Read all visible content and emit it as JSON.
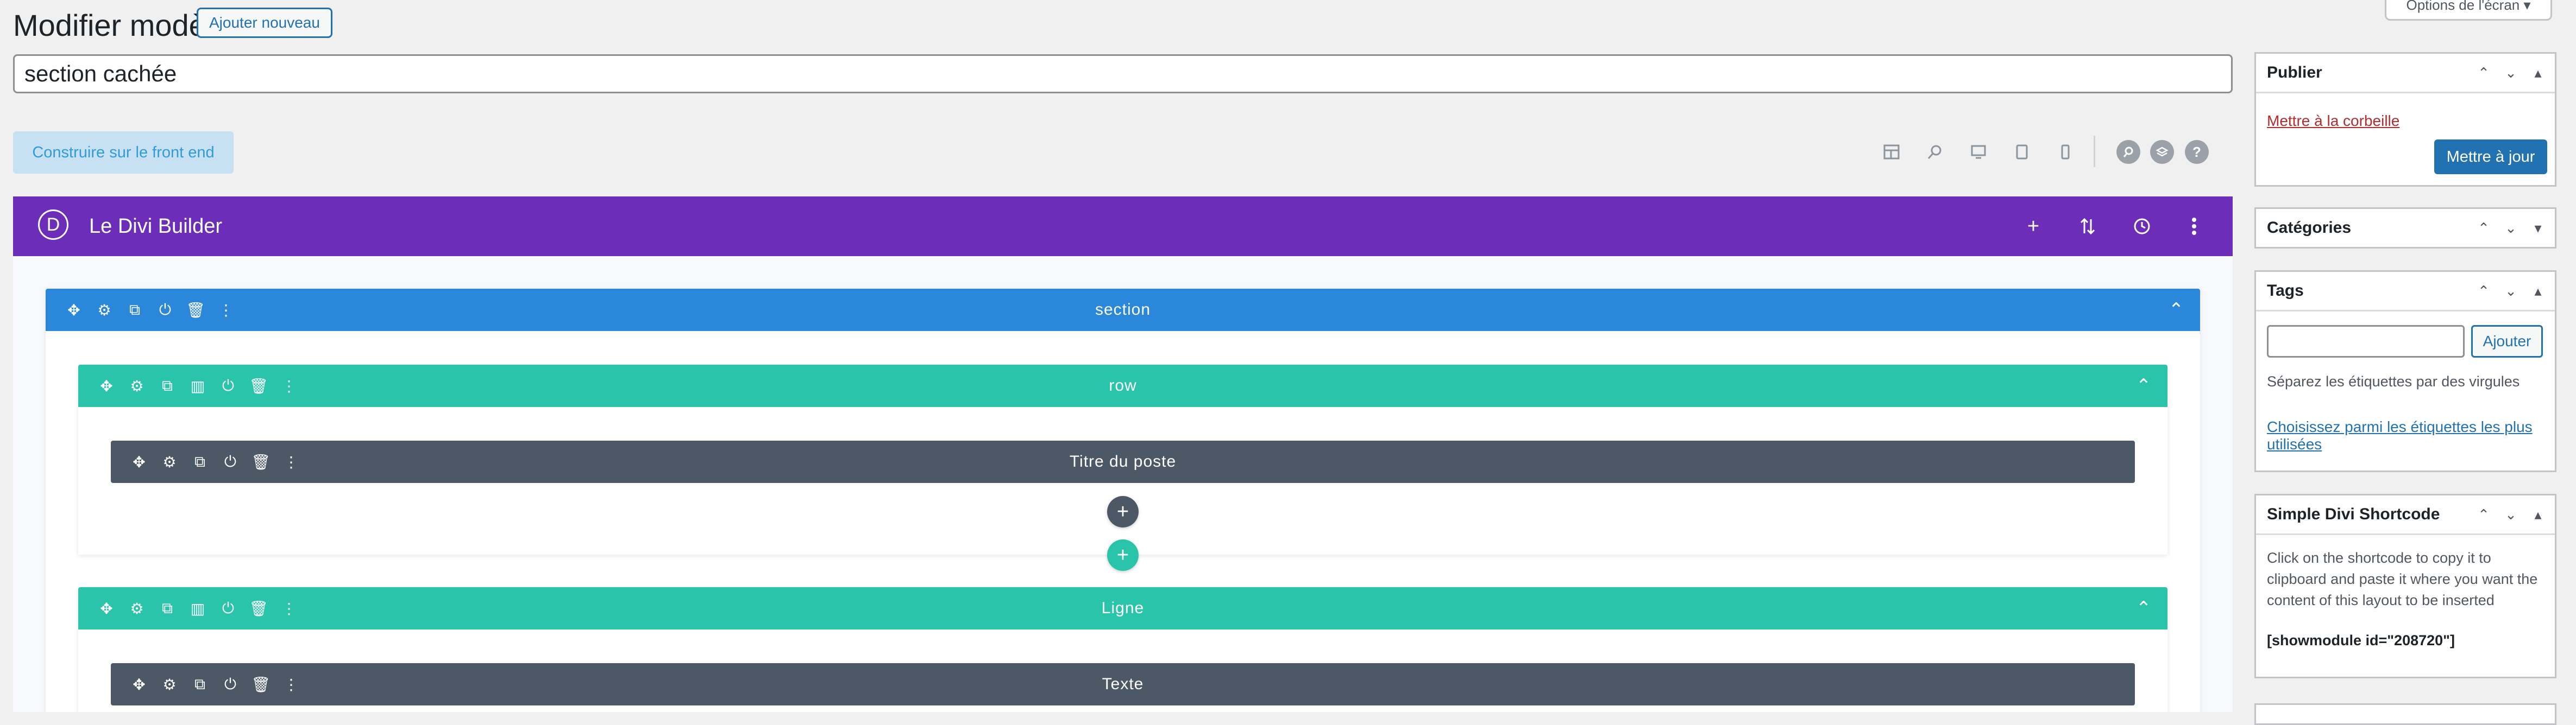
{
  "header": {
    "title": "Modifier modèle",
    "add_new": "Ajouter nouveau",
    "screen_options": "Options de l'écran ▾"
  },
  "post": {
    "title_value": "section cachée"
  },
  "toolbar": {
    "front_end_button": "Construire sur le front end"
  },
  "builder": {
    "title": "Le Divi Builder",
    "logo_letter": "D",
    "section_label": "section",
    "rows": [
      {
        "label": "row",
        "module_label": "Titre du poste"
      },
      {
        "label": "Ligne",
        "module_label": "Texte"
      }
    ]
  },
  "sidebar": {
    "publish": {
      "title": "Publier",
      "trash_link": "Mettre à la corbeille",
      "update_button": "Mettre à jour"
    },
    "categories": {
      "title": "Catégories"
    },
    "tags": {
      "title": "Tags",
      "add_button": "Ajouter",
      "hint": "Séparez les étiquettes par des virgules",
      "choose_link": "Choisissez parmi les étiquettes les plus utilisées"
    },
    "shortcode": {
      "title": "Simple Divi Shortcode",
      "description": "Click on the shortcode to copy it to clipboard and paste it where you want the content of this layout to be inserted",
      "code": "[showmodule id=\"208720\"]"
    }
  },
  "colors": {
    "divi_purple": "#6c2eb9",
    "section_blue": "#2b87da",
    "row_green": "#29c4a9",
    "module_gray": "#4c5866",
    "wp_blue": "#2271b1"
  }
}
